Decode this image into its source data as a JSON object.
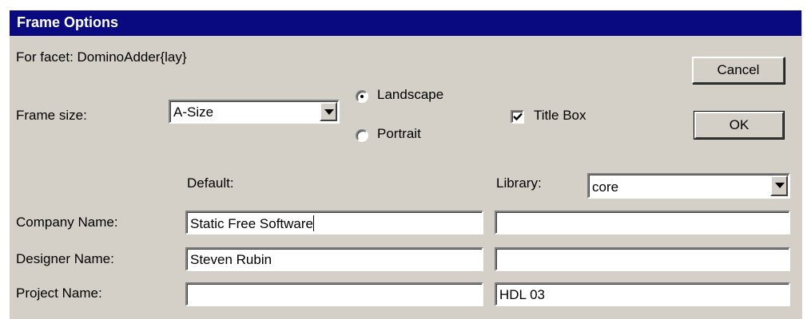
{
  "dialog": {
    "title": "Frame Options",
    "facet_label": "For facet: DominoAdder{lay}",
    "buttons": {
      "cancel": "Cancel",
      "ok": "OK"
    }
  },
  "frame": {
    "size_label": "Frame size:",
    "size_value": "A-Size",
    "orientation": {
      "landscape_label": "Landscape",
      "portrait_label": "Portrait",
      "selected": "Landscape"
    },
    "title_box_label": "Title Box",
    "title_box_checked": true
  },
  "columns": {
    "default_label": "Default:",
    "library_label": "Library:",
    "library_value": "core"
  },
  "rows": [
    {
      "label": "Company Name:",
      "default": "Static Free Software",
      "library": ""
    },
    {
      "label": "Designer Name:",
      "default": "Steven Rubin",
      "library": ""
    },
    {
      "label": "Project Name:",
      "default": "",
      "library": "HDL 03"
    }
  ],
  "colors": {
    "title_bar": "#0a0a80",
    "dialog_face": "#d4d0c8"
  }
}
